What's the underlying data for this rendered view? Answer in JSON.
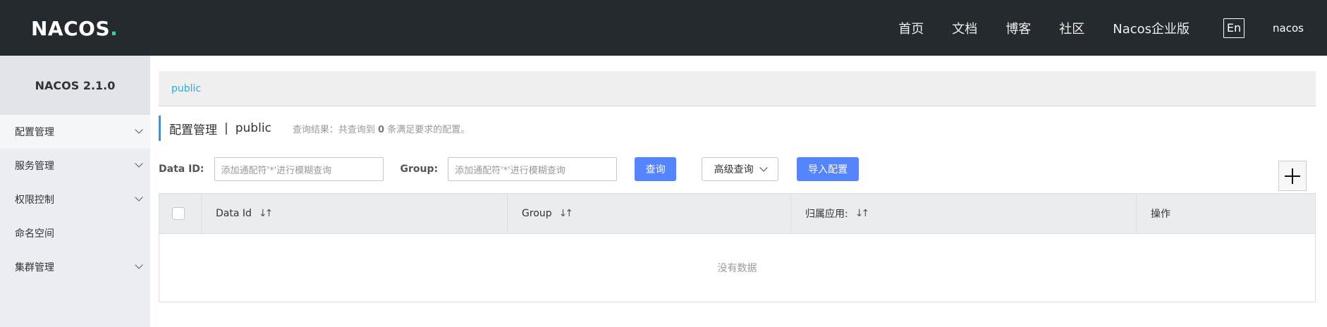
{
  "header": {
    "logo_text": "NACOS",
    "logo_dot": ".",
    "nav": [
      "首页",
      "文档",
      "博客",
      "社区",
      "Nacos企业版"
    ],
    "lang": "En",
    "user": "nacos"
  },
  "sidebar": {
    "version": "NACOS 2.1.0",
    "items": [
      {
        "label": "配置管理"
      },
      {
        "label": "服务管理"
      },
      {
        "label": "权限控制"
      },
      {
        "label": "命名空间"
      },
      {
        "label": "集群管理"
      }
    ]
  },
  "main": {
    "breadcrumb": "public",
    "title": "配置管理",
    "separator": "|",
    "namespace": "public",
    "result_prefix": "查询结果：共查询到",
    "result_count": "0",
    "result_suffix": "条满足要求的配置。",
    "filters": {
      "data_id_label": "Data ID:",
      "data_id_placeholder": "添加通配符'*'进行模糊查询",
      "group_label": "Group:",
      "group_placeholder": "添加通配符'*'进行模糊查询",
      "query_button": "查询",
      "advanced_button": "高级查询",
      "import_button": "导入配置"
    },
    "table": {
      "columns": [
        "Data Id",
        "Group",
        "归属应用:",
        "操作"
      ],
      "sort_glyph": "↓↑",
      "empty_text": "没有数据"
    }
  },
  "colors": {
    "header_bg": "#252a2f",
    "sidebar_bg": "#eaedf1",
    "primary": "#5584ff",
    "link": "#29a9e1"
  }
}
